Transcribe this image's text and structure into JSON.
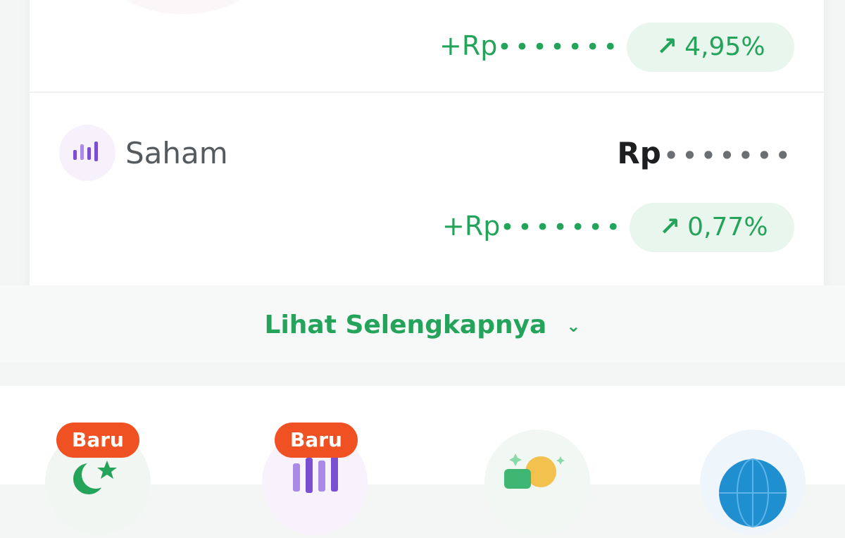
{
  "holdings": [
    {
      "label": "",
      "gain_prefix": "+Rp",
      "gain_masked": "•••••••",
      "change_arrow": "↗",
      "change_percent": "4,95%"
    },
    {
      "label": "Saham",
      "value_prefix": "Rp",
      "value_masked": "•••••••",
      "gain_prefix": "+Rp",
      "gain_masked": "•••••••",
      "change_arrow": "↗",
      "change_percent": "0,77%",
      "icon": "candlestick-chart-icon"
    }
  ],
  "see_more": {
    "label": "Lihat Selengkapnya",
    "icon": "chevron-down-icon"
  },
  "menu": [
    {
      "badge": "Baru",
      "icon": "crescent-star-icon"
    },
    {
      "badge": "Baru",
      "icon": "candlestick-chart-icon"
    },
    {
      "badge": "",
      "icon": "gold-coin-wallet-icon"
    },
    {
      "badge": "",
      "icon": "globe-icon"
    }
  ],
  "colors": {
    "positive": "#24a35a",
    "pill_bg": "#e9f6ee",
    "badge_bg": "#f05123",
    "saham_icon": "#7b4fd1"
  }
}
